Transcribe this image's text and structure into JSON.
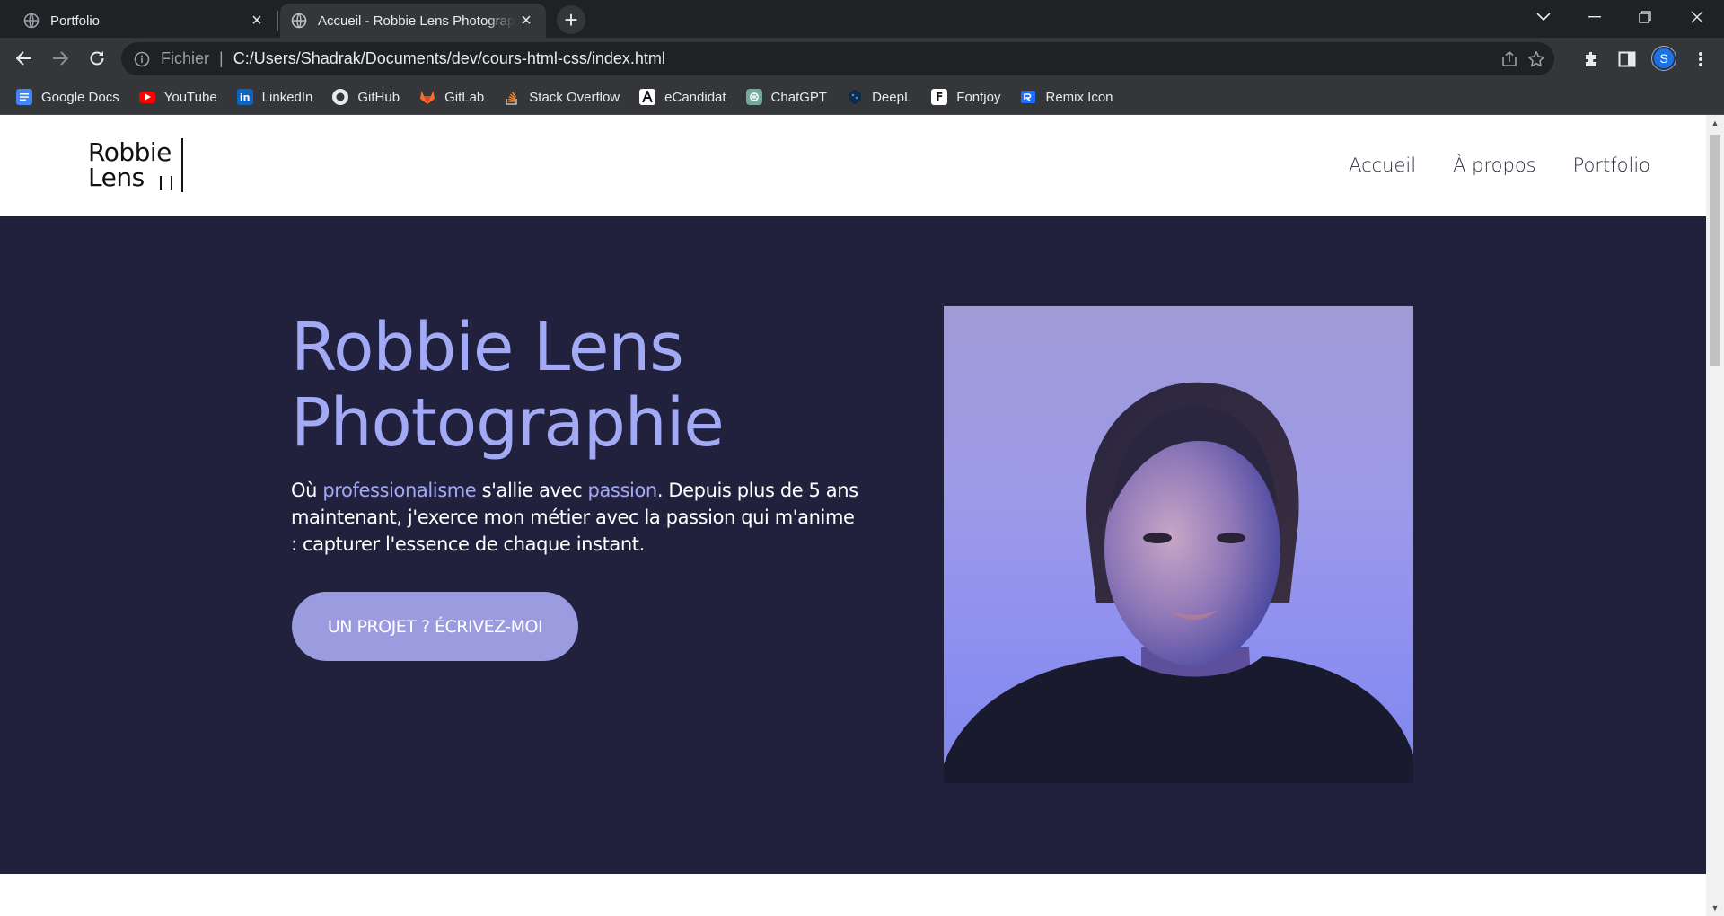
{
  "browser": {
    "tabs": [
      {
        "title": "Portfolio",
        "active": false
      },
      {
        "title": "Accueil - Robbie Lens Photographie",
        "active": true
      }
    ],
    "address": {
      "scheme_label": "Fichier",
      "path": "C:/Users/Shadrak/Documents/dev/cours-html-css/index.html"
    },
    "profile_initial": "S",
    "bookmarks": [
      {
        "label": "Google Docs",
        "icon": "google-docs-icon",
        "color": "#4285f4"
      },
      {
        "label": "YouTube",
        "icon": "youtube-icon",
        "color": "#ff0000"
      },
      {
        "label": "LinkedIn",
        "icon": "linkedin-icon",
        "color": "#0a66c2"
      },
      {
        "label": "GitHub",
        "icon": "github-icon",
        "color": "#ffffff"
      },
      {
        "label": "GitLab",
        "icon": "gitlab-icon",
        "color": "#fc6d26"
      },
      {
        "label": "Stack Overflow",
        "icon": "stackoverflow-icon",
        "color": "#f48024"
      },
      {
        "label": "eCandidat",
        "icon": "ecandidat-icon",
        "color": "#ffffff"
      },
      {
        "label": "ChatGPT",
        "icon": "chatgpt-icon",
        "color": "#74aa9c"
      },
      {
        "label": "DeepL",
        "icon": "deepl-icon",
        "color": "#0f2b46"
      },
      {
        "label": "Fontjoy",
        "icon": "fontjoy-icon",
        "color": "#ffffff"
      },
      {
        "label": "Remix Icon",
        "icon": "remix-icon",
        "color": "#1e6fff"
      }
    ]
  },
  "site": {
    "logo": {
      "line1": "Robbie",
      "line2": "Lens"
    },
    "nav": [
      "Accueil",
      "À propos",
      "Portfolio"
    ],
    "hero": {
      "title_line1": "Robbie Lens",
      "title_line2": "Photographie",
      "text": {
        "p1": "Où ",
        "hl1": "professionalisme",
        "p2": " s'allie avec ",
        "hl2": "passion",
        "p3": ". Depuis plus de 5 ans maintenant, j'exerce mon métier avec la passion qui m'anime : capturer l'essence de chaque instant."
      },
      "cta": "UN PROJET ? ÉCRIVEZ-MOI",
      "image_alt": "portrait-photo"
    }
  },
  "colors": {
    "accent": "#a3aaf5",
    "hero_bg": "#21213e",
    "cta_bg": "#9b9be0"
  }
}
